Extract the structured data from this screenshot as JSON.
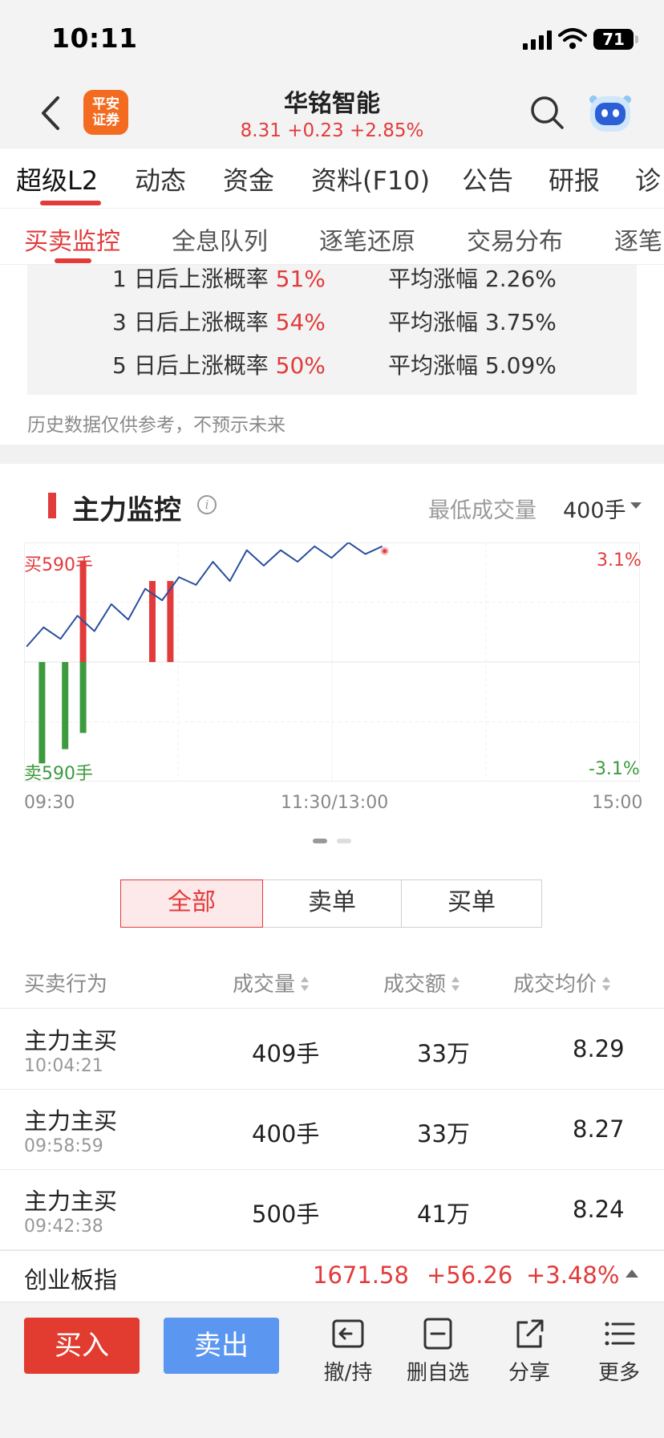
{
  "status_bar": {
    "time": "10:11",
    "battery": "71"
  },
  "header": {
    "broker_logo_line1": "平安",
    "broker_logo_line2": "证券",
    "stock_name": "华铭智能",
    "quote": "8.31 +0.23 +2.85%"
  },
  "tabs_primary": [
    "超级L2",
    "动态",
    "资金",
    "资料(F10)",
    "公告",
    "研报",
    "诊"
  ],
  "tabs_secondary": [
    "买卖监控",
    "全息队列",
    "逐笔还原",
    "交易分布",
    "逐笔"
  ],
  "probability": {
    "rows": [
      {
        "label": "1 日后上涨概率",
        "pct": "51%",
        "avg_label": "平均涨幅",
        "avg": "2.26%"
      },
      {
        "label": "3 日后上涨概率",
        "pct": "54%",
        "avg_label": "平均涨幅",
        "avg": "3.75%"
      },
      {
        "label": "5 日后上涨概率",
        "pct": "50%",
        "avg_label": "平均涨幅",
        "avg": "5.09%"
      }
    ],
    "disclaimer": "历史数据仅供参考，不预示未来"
  },
  "main_monitor": {
    "title": "主力监控",
    "info_icon": "i",
    "min_volume_label": "最低成交量",
    "min_volume_value": "400手"
  },
  "chart_data": {
    "type": "line",
    "top_left_label": "买590手",
    "bottom_left_label": "卖590手",
    "top_right_label": "3.1%",
    "bottom_right_label": "-3.1%",
    "x_tick_labels": [
      "09:30",
      "11:30/13:00",
      "15:00"
    ],
    "ylim_pct": [
      -3.1,
      3.1
    ],
    "ylim_volume": [
      -590,
      590
    ],
    "price_change_pct": [
      0.4,
      0.9,
      0.6,
      1.2,
      0.8,
      1.5,
      1.1,
      1.9,
      1.6,
      2.2,
      2.0,
      2.6,
      2.1,
      2.9,
      2.5,
      2.9,
      2.6,
      3.0,
      2.7,
      3.1,
      2.8,
      3.0
    ],
    "bars": [
      {
        "minute": 7,
        "volume": -500
      },
      {
        "minute": 16,
        "volume": -430
      },
      {
        "minute": 23,
        "volume": 500
      },
      {
        "minute": 23,
        "volume": -350
      },
      {
        "minute": 50,
        "volume": 400
      },
      {
        "minute": 57,
        "volume": 400
      }
    ],
    "colors": {
      "buy": "#e23b3b",
      "sell": "#3e9a3e",
      "line": "#2a4f9e"
    }
  },
  "segment": {
    "all": "全部",
    "sell_orders": "卖单",
    "buy_orders": "买单"
  },
  "table": {
    "headers": [
      "买卖行为",
      "成交量",
      "成交额",
      "成交均价"
    ],
    "rows": [
      {
        "action": "主力主买",
        "time": "10:04:21",
        "volume": "409手",
        "amount": "33万",
        "avg_price": "8.29"
      },
      {
        "action": "主力主买",
        "time": "09:58:59",
        "volume": "400手",
        "amount": "33万",
        "avg_price": "8.27"
      },
      {
        "action": "主力主买",
        "time": "09:42:38",
        "volume": "500手",
        "amount": "41万",
        "avg_price": "8.24"
      }
    ]
  },
  "index_bar": {
    "name": "创业板指",
    "value": "1671.58",
    "change": "+56.26",
    "change_pct": "+3.48%"
  },
  "toolbar": {
    "buy": "买入",
    "sell": "卖出",
    "items": [
      {
        "label": "撤/持",
        "icon": "cancel-hold-icon"
      },
      {
        "label": "删自选",
        "icon": "remove-favorite-icon"
      },
      {
        "label": "分享",
        "icon": "share-icon"
      },
      {
        "label": "更多",
        "icon": "more-icon"
      }
    ]
  }
}
